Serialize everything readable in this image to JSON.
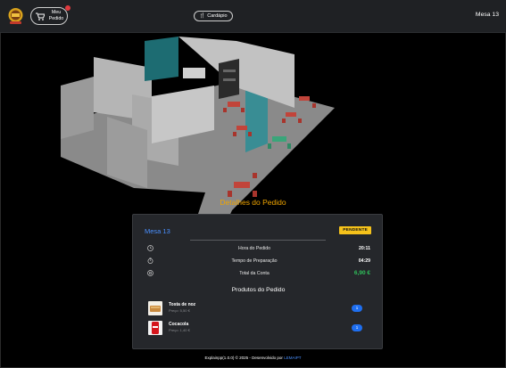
{
  "header": {
    "order_button_label": "Meu Pedido",
    "menu_button_label": "Cardápio",
    "table_label": "Mesa 13"
  },
  "details": {
    "title": "Detalhes do Pedido",
    "table": "Mesa 13",
    "status": "PENDENTE",
    "rows": [
      {
        "label": "Hora do Pedido",
        "value": "20:11",
        "icon": "clock-icon"
      },
      {
        "label": "Tempo de Preparação",
        "value": "04:29",
        "icon": "timer-icon"
      },
      {
        "label": "Total da Conta",
        "value": "6,90 €",
        "icon": "money-icon"
      }
    ],
    "products_title": "Produtos do Pedido",
    "products": [
      {
        "name": "Tosta de noz",
        "price": "Preço: 5,50 €",
        "qty": "1"
      },
      {
        "name": "Cocacola",
        "price": "Preço: 1,40 €",
        "qty": "1"
      }
    ]
  },
  "footer": {
    "text": "Explainpp(1.0.0) © 2025 - Desenvolvido por",
    "brand": "LEMAIPT"
  },
  "colors": {
    "header_bg": "#1f2124",
    "card_bg": "#25272b",
    "accent_orange": "#f0a500",
    "accent_blue": "#4a90ff",
    "status_yellow": "#f5c21b",
    "total_green": "#2fbf5a"
  }
}
